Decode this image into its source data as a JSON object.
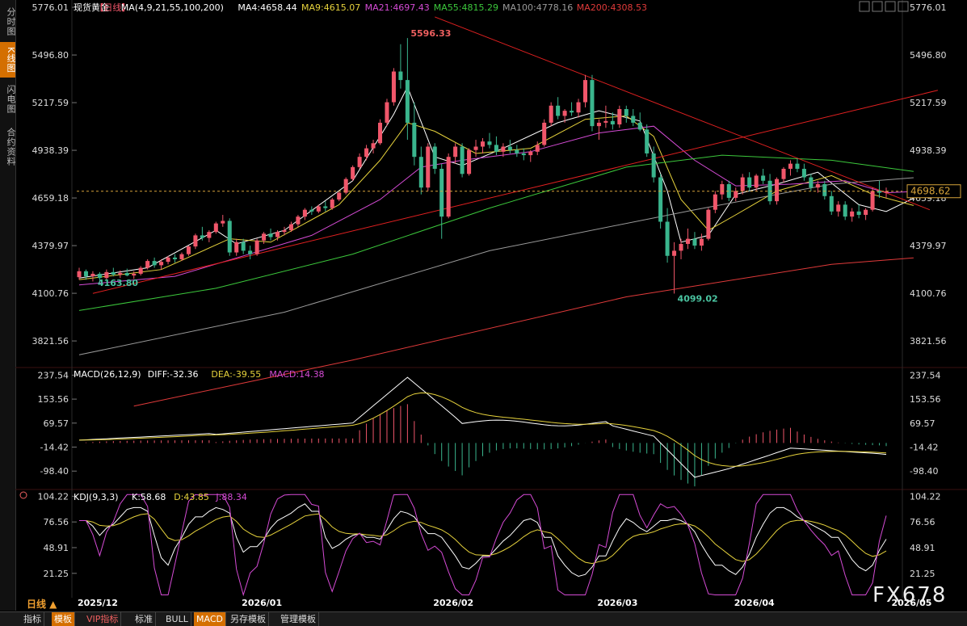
{
  "side_tabs": [
    {
      "label": "分时图",
      "active": false
    },
    {
      "label": "K线图",
      "active": true
    },
    {
      "label": "闪电图",
      "active": false
    },
    {
      "label": "合约资料",
      "active": false
    }
  ],
  "main": {
    "title": "现货黄金",
    "period": "【日线】",
    "ma_set": "MA(4,9,21,55,100,200)",
    "ma_values": [
      {
        "label": "MA4:4658.44",
        "color": "#ffffff"
      },
      {
        "label": "MA9:4615.07",
        "color": "#e6d23c"
      },
      {
        "label": "MA21:4697.43",
        "color": "#d54bd5"
      },
      {
        "label": "MA55:4815.29",
        "color": "#3cc83c"
      },
      {
        "label": "MA100:4778.16",
        "color": "#9a9a9a"
      },
      {
        "label": "MA200:4308.53",
        "color": "#e03a3a"
      }
    ],
    "y_ticks": [
      "5776.01",
      "5496.80",
      "5217.59",
      "4938.39",
      "4659.18",
      "4379.97",
      "4100.76",
      "3821.56"
    ],
    "y_range": [
      3680,
      5800
    ],
    "current_price": "4698.62",
    "high_label": "5596.33",
    "low_label": "4099.02",
    "start_label": "4163.80"
  },
  "macd": {
    "title": "MACD(26,12,9)",
    "diff": "DIFF:-32.36",
    "dea": "DEA:-39.55",
    "macd": "MACD:14.38",
    "y_ticks": [
      "237.54",
      "153.56",
      "69.57",
      "-14.42",
      "-98.40"
    ],
    "y_range": [
      -160,
      250
    ]
  },
  "kdj": {
    "title": "KDJ(9,3,3)",
    "k": "K:58.68",
    "d": "D:43.85",
    "j": "J:88.34",
    "y_ticks": [
      "104.22",
      "76.56",
      "48.91",
      "21.25"
    ],
    "y_range": [
      -5,
      108
    ]
  },
  "x_labels": [
    "2025/12",
    "2026/01",
    "2026/02",
    "2026/03",
    "2026/04",
    "2026/05"
  ],
  "period_selector": "日线 ▲",
  "toolbar": [
    "指标",
    "模板",
    "VIP指标",
    "标准",
    "BULL",
    "MACD",
    "另存模板",
    "管理模板"
  ],
  "toolbar_active": [
    "模板",
    "MACD"
  ],
  "watermark": "FX678",
  "colors": {
    "up": "#f0566a",
    "down": "#3ab58d",
    "accent": "#d46f00",
    "dash": "#d6a33a"
  },
  "chart_data": {
    "type": "candlestick",
    "x_start": "2025-12-01",
    "x_end": "2026-05-06",
    "ohlc": [
      [
        4195,
        4250,
        4180,
        4230
      ],
      [
        4230,
        4240,
        4180,
        4200
      ],
      [
        4200,
        4230,
        4170,
        4215
      ],
      [
        4215,
        4225,
        4165,
        4190
      ],
      [
        4190,
        4240,
        4180,
        4225
      ],
      [
        4225,
        4250,
        4200,
        4210
      ],
      [
        4210,
        4235,
        4190,
        4220
      ],
      [
        4220,
        4245,
        4200,
        4205
      ],
      [
        4205,
        4230,
        4185,
        4215
      ],
      [
        4215,
        4260,
        4205,
        4250
      ],
      [
        4250,
        4300,
        4240,
        4290
      ],
      [
        4290,
        4310,
        4250,
        4265
      ],
      [
        4265,
        4300,
        4240,
        4285
      ],
      [
        4285,
        4320,
        4270,
        4310
      ],
      [
        4310,
        4330,
        4280,
        4300
      ],
      [
        4300,
        4340,
        4290,
        4330
      ],
      [
        4330,
        4380,
        4320,
        4375
      ],
      [
        4375,
        4450,
        4360,
        4440
      ],
      [
        4440,
        4490,
        4410,
        4425
      ],
      [
        4425,
        4470,
        4400,
        4460
      ],
      [
        4460,
        4520,
        4450,
        4510
      ],
      [
        4510,
        4560,
        4490,
        4525
      ],
      [
        4525,
        4540,
        4320,
        4340
      ],
      [
        4340,
        4420,
        4320,
        4400
      ],
      [
        4400,
        4420,
        4330,
        4350
      ],
      [
        4350,
        4380,
        4300,
        4330
      ],
      [
        4330,
        4420,
        4320,
        4410
      ],
      [
        4410,
        4460,
        4390,
        4450
      ],
      [
        4450,
        4480,
        4410,
        4430
      ],
      [
        4430,
        4470,
        4410,
        4460
      ],
      [
        4460,
        4490,
        4440,
        4470
      ],
      [
        4470,
        4520,
        4460,
        4505
      ],
      [
        4505,
        4560,
        4490,
        4550
      ],
      [
        4550,
        4600,
        4530,
        4590
      ],
      [
        4590,
        4610,
        4560,
        4580
      ],
      [
        4580,
        4620,
        4570,
        4610
      ],
      [
        4610,
        4640,
        4580,
        4600
      ],
      [
        4600,
        4660,
        4590,
        4650
      ],
      [
        4650,
        4700,
        4640,
        4690
      ],
      [
        4690,
        4780,
        4680,
        4770
      ],
      [
        4770,
        4850,
        4760,
        4840
      ],
      [
        4840,
        4920,
        4830,
        4900
      ],
      [
        4900,
        4970,
        4880,
        4950
      ],
      [
        4950,
        5000,
        4920,
        4980
      ],
      [
        4980,
        5120,
        4970,
        5100
      ],
      [
        5100,
        5240,
        5080,
        5220
      ],
      [
        5220,
        5420,
        5200,
        5400
      ],
      [
        5400,
        5560,
        5300,
        5350
      ],
      [
        5350,
        5596,
        5000,
        5100
      ],
      [
        5100,
        5220,
        4850,
        4900
      ],
      [
        4900,
        4960,
        4680,
        4720
      ],
      [
        4720,
        4980,
        4700,
        4960
      ],
      [
        4960,
        4980,
        4800,
        4830
      ],
      [
        4830,
        4860,
        4420,
        4550
      ],
      [
        4550,
        4920,
        4540,
        4900
      ],
      [
        4900,
        4980,
        4860,
        4960
      ],
      [
        4960,
        4980,
        4780,
        4800
      ],
      [
        4800,
        4950,
        4790,
        4940
      ],
      [
        4940,
        5000,
        4900,
        4960
      ],
      [
        4960,
        5010,
        4920,
        4990
      ],
      [
        4990,
        5040,
        4950,
        4970
      ],
      [
        4970,
        5020,
        4910,
        4930
      ],
      [
        4930,
        4980,
        4900,
        4960
      ],
      [
        4960,
        5000,
        4920,
        4940
      ],
      [
        4940,
        4970,
        4900,
        4920
      ],
      [
        4920,
        4950,
        4880,
        4910
      ],
      [
        4910,
        4940,
        4870,
        4930
      ],
      [
        4930,
        4990,
        4910,
        4970
      ],
      [
        4970,
        5120,
        4960,
        5100
      ],
      [
        5100,
        5220,
        5080,
        5200
      ],
      [
        5200,
        5250,
        5120,
        5140
      ],
      [
        5140,
        5180,
        5100,
        5170
      ],
      [
        5170,
        5220,
        5140,
        5160
      ],
      [
        5160,
        5240,
        5130,
        5220
      ],
      [
        5220,
        5380,
        5190,
        5350
      ],
      [
        5350,
        5380,
        5050,
        5080
      ],
      [
        5080,
        5120,
        5000,
        5100
      ],
      [
        5100,
        5200,
        5070,
        5110
      ],
      [
        5110,
        5160,
        5060,
        5090
      ],
      [
        5090,
        5200,
        5070,
        5180
      ],
      [
        5180,
        5200,
        5100,
        5140
      ],
      [
        5140,
        5180,
        5080,
        5100
      ],
      [
        5100,
        5160,
        5050,
        5060
      ],
      [
        5060,
        5090,
        4900,
        4920
      ],
      [
        4920,
        4960,
        4750,
        4780
      ],
      [
        4780,
        4800,
        4480,
        4520
      ],
      [
        4520,
        4600,
        4280,
        4320
      ],
      [
        4320,
        4400,
        4099,
        4350
      ],
      [
        4350,
        4420,
        4300,
        4390
      ],
      [
        4390,
        4480,
        4360,
        4420
      ],
      [
        4420,
        4460,
        4360,
        4380
      ],
      [
        4380,
        4450,
        4350,
        4420
      ],
      [
        4420,
        4600,
        4410,
        4590
      ],
      [
        4590,
        4700,
        4570,
        4680
      ],
      [
        4680,
        4760,
        4650,
        4740
      ],
      [
        4740,
        4760,
        4640,
        4660
      ],
      [
        4660,
        4720,
        4640,
        4700
      ],
      [
        4700,
        4800,
        4680,
        4780
      ],
      [
        4780,
        4810,
        4700,
        4720
      ],
      [
        4720,
        4800,
        4700,
        4790
      ],
      [
        4790,
        4830,
        4740,
        4760
      ],
      [
        4760,
        4800,
        4620,
        4640
      ],
      [
        4640,
        4780,
        4620,
        4770
      ],
      [
        4770,
        4840,
        4750,
        4830
      ],
      [
        4830,
        4880,
        4790,
        4860
      ],
      [
        4860,
        4890,
        4810,
        4830
      ],
      [
        4830,
        4860,
        4760,
        4780
      ],
      [
        4780,
        4800,
        4700,
        4720
      ],
      [
        4720,
        4760,
        4690,
        4740
      ],
      [
        4740,
        4760,
        4650,
        4670
      ],
      [
        4670,
        4700,
        4560,
        4580
      ],
      [
        4580,
        4640,
        4550,
        4620
      ],
      [
        4620,
        4640,
        4530,
        4550
      ],
      [
        4550,
        4600,
        4520,
        4580
      ],
      [
        4580,
        4620,
        4540,
        4560
      ],
      [
        4560,
        4600,
        4530,
        4590
      ],
      [
        4590,
        4720,
        4580,
        4700
      ],
      [
        4700,
        4760,
        4660,
        4690
      ],
      [
        4690,
        4720,
        4660,
        4698
      ]
    ],
    "ma_lines": [
      {
        "name": "MA4",
        "color": "#ffffff",
        "points": [
          [
            0,
            4190
          ],
          [
            10,
            4250
          ],
          [
            20,
            4470
          ],
          [
            23,
            4390
          ],
          [
            30,
            4470
          ],
          [
            40,
            4760
          ],
          [
            46,
            5150
          ],
          [
            48,
            5310
          ],
          [
            52,
            4900
          ],
          [
            56,
            4850
          ],
          [
            62,
            4950
          ],
          [
            70,
            5100
          ],
          [
            76,
            5170
          ],
          [
            82,
            5110
          ],
          [
            86,
            4700
          ],
          [
            88,
            4400
          ],
          [
            92,
            4440
          ],
          [
            96,
            4680
          ],
          [
            102,
            4740
          ],
          [
            108,
            4810
          ],
          [
            114,
            4620
          ],
          [
            118,
            4580
          ],
          [
            122,
            4658
          ]
        ]
      },
      {
        "name": "MA9",
        "color": "#e6d23c",
        "points": [
          [
            0,
            4180
          ],
          [
            12,
            4240
          ],
          [
            22,
            4420
          ],
          [
            28,
            4400
          ],
          [
            38,
            4620
          ],
          [
            44,
            4880
          ],
          [
            48,
            5100
          ],
          [
            52,
            5050
          ],
          [
            58,
            4920
          ],
          [
            66,
            4950
          ],
          [
            74,
            5120
          ],
          [
            80,
            5140
          ],
          [
            84,
            5020
          ],
          [
            88,
            4650
          ],
          [
            92,
            4470
          ],
          [
            96,
            4560
          ],
          [
            102,
            4700
          ],
          [
            110,
            4790
          ],
          [
            116,
            4680
          ],
          [
            122,
            4615
          ]
        ]
      },
      {
        "name": "MA21",
        "color": "#d54bd5",
        "points": [
          [
            0,
            4150
          ],
          [
            14,
            4200
          ],
          [
            24,
            4320
          ],
          [
            34,
            4440
          ],
          [
            44,
            4650
          ],
          [
            50,
            4840
          ],
          [
            56,
            4880
          ],
          [
            66,
            4930
          ],
          [
            76,
            5040
          ],
          [
            84,
            5080
          ],
          [
            90,
            4880
          ],
          [
            96,
            4730
          ],
          [
            104,
            4740
          ],
          [
            112,
            4760
          ],
          [
            118,
            4690
          ],
          [
            122,
            4697
          ]
        ]
      },
      {
        "name": "MA55",
        "color": "#3cc83c",
        "points": [
          [
            0,
            4000
          ],
          [
            20,
            4130
          ],
          [
            40,
            4330
          ],
          [
            60,
            4600
          ],
          [
            80,
            4840
          ],
          [
            94,
            4910
          ],
          [
            110,
            4880
          ],
          [
            122,
            4815
          ]
        ]
      },
      {
        "name": "MA100",
        "color": "#9a9a9a",
        "points": [
          [
            0,
            3740
          ],
          [
            30,
            3990
          ],
          [
            60,
            4350
          ],
          [
            90,
            4590
          ],
          [
            110,
            4740
          ],
          [
            122,
            4778
          ]
        ]
      },
      {
        "name": "MA200",
        "color": "#e03a3a",
        "points": [
          [
            8,
            3440
          ],
          [
            40,
            3710
          ],
          [
            80,
            4080
          ],
          [
            110,
            4270
          ],
          [
            122,
            4308
          ]
        ]
      }
    ]
  }
}
